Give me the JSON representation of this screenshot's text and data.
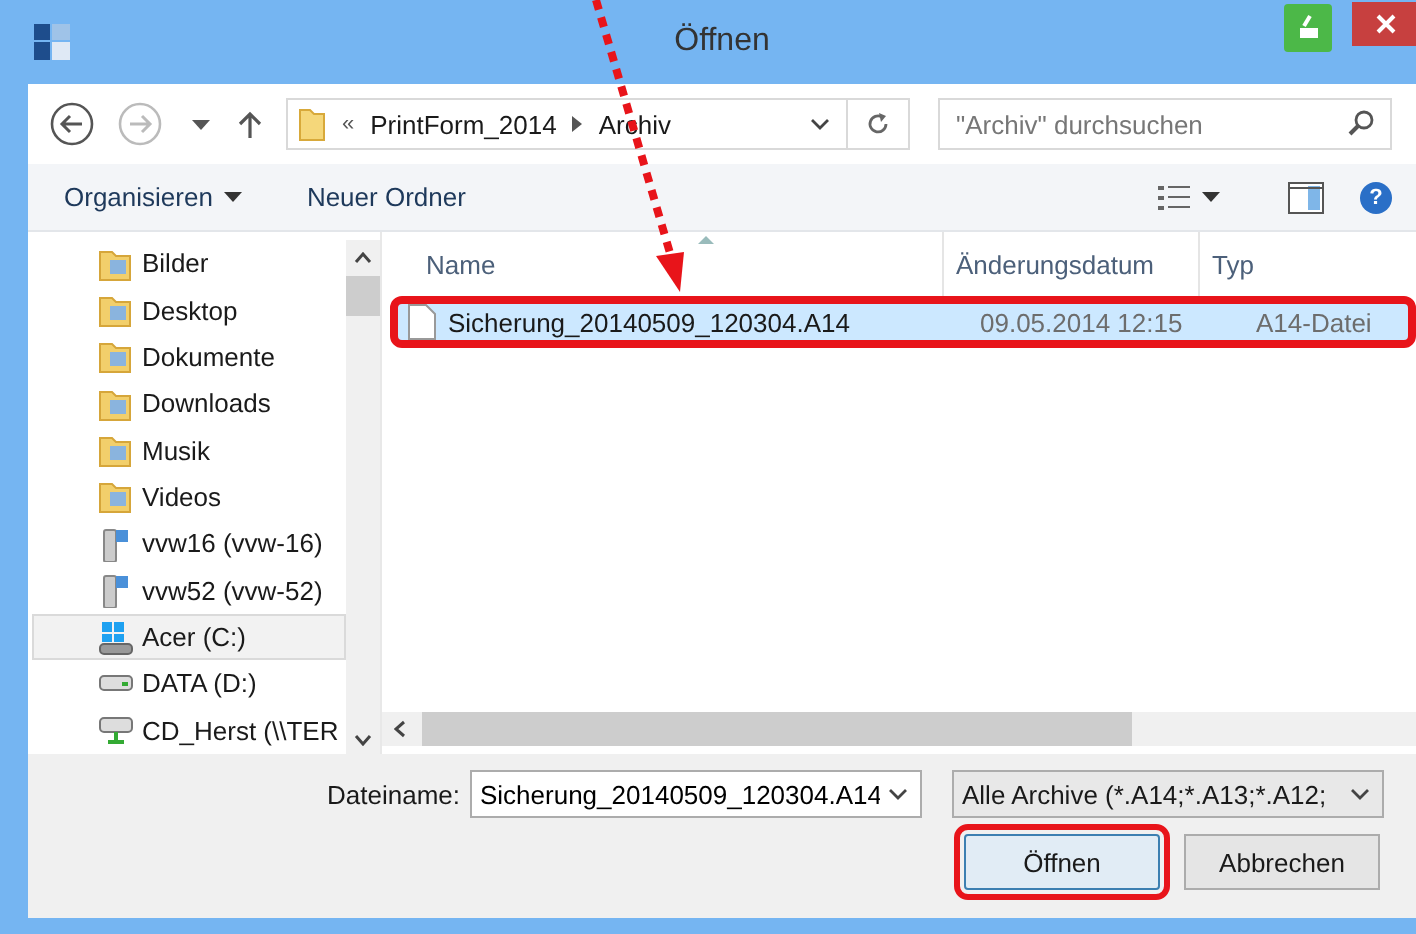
{
  "window": {
    "title": "Öffnen"
  },
  "navigation": {
    "path": [
      {
        "label": "PrintForm_2014"
      },
      {
        "label": "Archiv"
      }
    ],
    "overflow": "«",
    "search": {
      "placeholder": "\"Archiv\" durchsuchen"
    }
  },
  "toolbar": {
    "items": [
      {
        "label": "Organisieren",
        "dropdown": true
      },
      {
        "label": "Neuer Ordner",
        "dropdown": false
      }
    ],
    "help": "?"
  },
  "sidebar": {
    "items": [
      {
        "label": "Bilder",
        "kind": "folder",
        "selected": false
      },
      {
        "label": "Desktop",
        "kind": "folder",
        "selected": false
      },
      {
        "label": "Dokumente",
        "kind": "folder",
        "selected": false
      },
      {
        "label": "Downloads",
        "kind": "folder",
        "selected": false
      },
      {
        "label": "Musik",
        "kind": "folder",
        "selected": false
      },
      {
        "label": "Videos",
        "kind": "folder",
        "selected": false
      },
      {
        "label": "vvw16 (vvw-16)",
        "kind": "network",
        "selected": false
      },
      {
        "label": "vvw52 (vvw-52)",
        "kind": "network",
        "selected": false
      },
      {
        "label": "Acer (C:)",
        "kind": "system",
        "selected": true
      },
      {
        "label": "DATA (D:)",
        "kind": "drive",
        "selected": false
      },
      {
        "label": "CD_Herst (\\\\TER",
        "kind": "netdrive",
        "selected": false
      }
    ]
  },
  "file_list": {
    "columns": [
      "Name",
      "Änderungsdatum",
      "Typ"
    ],
    "rows": [
      {
        "name": "Sicherung_20140509_120304.A14",
        "date": "09.05.2014 12:15",
        "type": "A14-Datei",
        "selected": true,
        "highlighted": true
      }
    ]
  },
  "footer": {
    "filename_label": "Dateiname:",
    "filename": "Sicherung_20140509_120304.A14",
    "filter": "Alle Archive (*.A14;*.A13;*.A12;",
    "buttons": [
      {
        "label": "Öffnen",
        "default": true,
        "highlighted": true
      },
      {
        "label": "Abbrechen",
        "default": false,
        "highlighted": false
      }
    ]
  },
  "annotation": {
    "pointer_arrow": true
  }
}
